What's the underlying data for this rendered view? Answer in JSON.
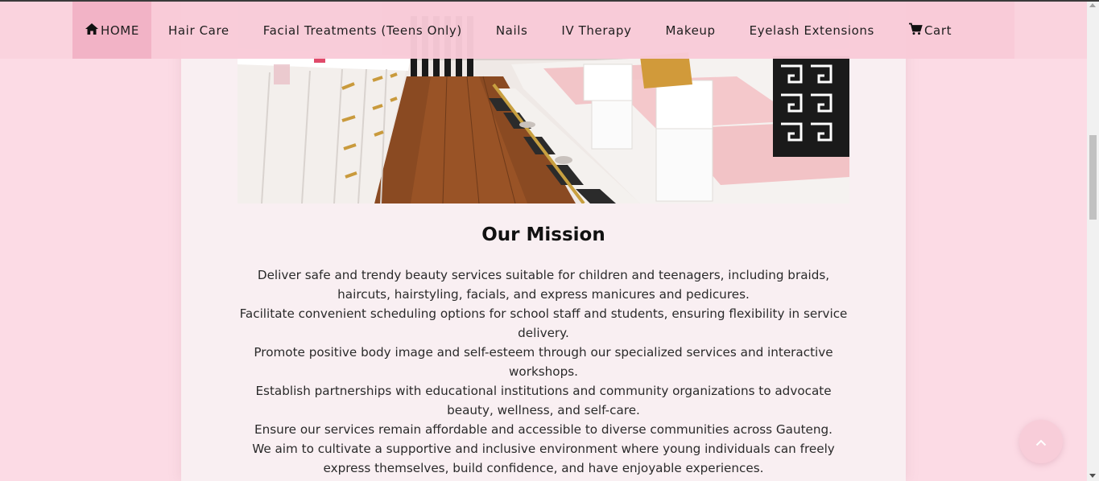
{
  "nav": {
    "items": [
      {
        "label": "HOME",
        "icon": "home-icon"
      },
      {
        "label": "Hair Care"
      },
      {
        "label": "Facial Treatments (Teens Only)"
      },
      {
        "label": "Nails"
      },
      {
        "label": "IV Therapy"
      },
      {
        "label": "Makeup"
      },
      {
        "label": "Eyelash Extensions"
      },
      {
        "label": "Cart",
        "icon": "cart-icon"
      }
    ],
    "active": "HOME"
  },
  "mission": {
    "title": "Our Mission",
    "paragraphs": [
      "Deliver safe and trendy beauty services suitable for children and teenagers, including braids, haircuts, hairstyling, facials, and express manicures and pedicures.",
      "Facilitate convenient scheduling options for school staff and students, ensuring flexibility in service delivery.",
      "Promote positive body image and self-esteem through our specialized services and interactive workshops.",
      "Establish partnerships with educational institutions and community organizations to advocate beauty, wellness, and self-care.",
      "Ensure our services remain affordable and accessible to diverse communities across Gauteng.",
      "We aim to cultivate a supportive and inclusive environment where young individuals can freely express themselves, build confidence, and have enjoyable experiences."
    ]
  },
  "back_to_top": {
    "icon": "chevron-up-icon"
  },
  "colors": {
    "page_bg": "#fcdbe5",
    "card_bg": "#f9eff2",
    "nav_active": "#f2b3c6",
    "accent": "#f8cdd9"
  }
}
